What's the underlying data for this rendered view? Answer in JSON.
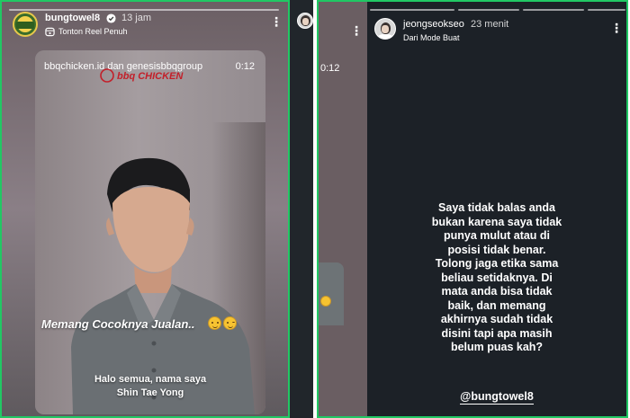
{
  "left_story": {
    "username": "bungtowel8",
    "time": "13 jam",
    "subtitle": "Tonton Reel Penuh",
    "reel": {
      "tags": "bbqchicken.id dan genesisbbqgroup",
      "duration": "0:12",
      "brand_text": "bbq CHICKEN",
      "caption_big": "Memang Cocoknya Jualan..",
      "caption_line1": "Halo semua, nama saya",
      "caption_line2": "Shin Tae Yong"
    }
  },
  "middle_peek": {
    "time": "0:12"
  },
  "right_story": {
    "username": "jeongseokseo",
    "time": "23 menit",
    "subtitle": "Dari Mode Buat",
    "message_lines": [
      "Saya tidak balas anda",
      "bukan karena saya tidak",
      "punya mulut atau di",
      "posisi tidak benar.",
      "Tolong jaga etika sama",
      "beliau setidaknya. Di",
      "mata anda bisa tidak",
      "baik, dan memang",
      "akhirnya sudah tidak",
      "disini tapi apa masih",
      "belum puas kah?"
    ],
    "mention": "@bungtowel8"
  },
  "colors": {
    "story_border": "#21c864",
    "dark_background": "#1c2127",
    "emoji_yellow": "#f7c331"
  },
  "icons": [
    "verified-badge-icon",
    "reel-icon",
    "more-options-icon",
    "emoji-icon"
  ]
}
